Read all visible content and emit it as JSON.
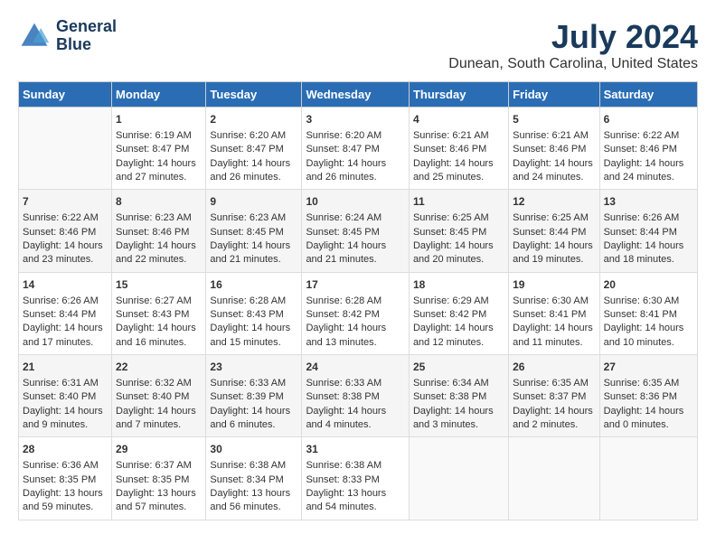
{
  "logo": {
    "line1": "General",
    "line2": "Blue"
  },
  "title": "July 2024",
  "subtitle": "Dunean, South Carolina, United States",
  "days_of_week": [
    "Sunday",
    "Monday",
    "Tuesday",
    "Wednesday",
    "Thursday",
    "Friday",
    "Saturday"
  ],
  "weeks": [
    [
      {
        "day": "",
        "sunrise": "",
        "sunset": "",
        "daylight": ""
      },
      {
        "day": "1",
        "sunrise": "Sunrise: 6:19 AM",
        "sunset": "Sunset: 8:47 PM",
        "daylight": "Daylight: 14 hours and 27 minutes."
      },
      {
        "day": "2",
        "sunrise": "Sunrise: 6:20 AM",
        "sunset": "Sunset: 8:47 PM",
        "daylight": "Daylight: 14 hours and 26 minutes."
      },
      {
        "day": "3",
        "sunrise": "Sunrise: 6:20 AM",
        "sunset": "Sunset: 8:47 PM",
        "daylight": "Daylight: 14 hours and 26 minutes."
      },
      {
        "day": "4",
        "sunrise": "Sunrise: 6:21 AM",
        "sunset": "Sunset: 8:46 PM",
        "daylight": "Daylight: 14 hours and 25 minutes."
      },
      {
        "day": "5",
        "sunrise": "Sunrise: 6:21 AM",
        "sunset": "Sunset: 8:46 PM",
        "daylight": "Daylight: 14 hours and 24 minutes."
      },
      {
        "day": "6",
        "sunrise": "Sunrise: 6:22 AM",
        "sunset": "Sunset: 8:46 PM",
        "daylight": "Daylight: 14 hours and 24 minutes."
      }
    ],
    [
      {
        "day": "7",
        "sunrise": "Sunrise: 6:22 AM",
        "sunset": "Sunset: 8:46 PM",
        "daylight": "Daylight: 14 hours and 23 minutes."
      },
      {
        "day": "8",
        "sunrise": "Sunrise: 6:23 AM",
        "sunset": "Sunset: 8:46 PM",
        "daylight": "Daylight: 14 hours and 22 minutes."
      },
      {
        "day": "9",
        "sunrise": "Sunrise: 6:23 AM",
        "sunset": "Sunset: 8:45 PM",
        "daylight": "Daylight: 14 hours and 21 minutes."
      },
      {
        "day": "10",
        "sunrise": "Sunrise: 6:24 AM",
        "sunset": "Sunset: 8:45 PM",
        "daylight": "Daylight: 14 hours and 21 minutes."
      },
      {
        "day": "11",
        "sunrise": "Sunrise: 6:25 AM",
        "sunset": "Sunset: 8:45 PM",
        "daylight": "Daylight: 14 hours and 20 minutes."
      },
      {
        "day": "12",
        "sunrise": "Sunrise: 6:25 AM",
        "sunset": "Sunset: 8:44 PM",
        "daylight": "Daylight: 14 hours and 19 minutes."
      },
      {
        "day": "13",
        "sunrise": "Sunrise: 6:26 AM",
        "sunset": "Sunset: 8:44 PM",
        "daylight": "Daylight: 14 hours and 18 minutes."
      }
    ],
    [
      {
        "day": "14",
        "sunrise": "Sunrise: 6:26 AM",
        "sunset": "Sunset: 8:44 PM",
        "daylight": "Daylight: 14 hours and 17 minutes."
      },
      {
        "day": "15",
        "sunrise": "Sunrise: 6:27 AM",
        "sunset": "Sunset: 8:43 PM",
        "daylight": "Daylight: 14 hours and 16 minutes."
      },
      {
        "day": "16",
        "sunrise": "Sunrise: 6:28 AM",
        "sunset": "Sunset: 8:43 PM",
        "daylight": "Daylight: 14 hours and 15 minutes."
      },
      {
        "day": "17",
        "sunrise": "Sunrise: 6:28 AM",
        "sunset": "Sunset: 8:42 PM",
        "daylight": "Daylight: 14 hours and 13 minutes."
      },
      {
        "day": "18",
        "sunrise": "Sunrise: 6:29 AM",
        "sunset": "Sunset: 8:42 PM",
        "daylight": "Daylight: 14 hours and 12 minutes."
      },
      {
        "day": "19",
        "sunrise": "Sunrise: 6:30 AM",
        "sunset": "Sunset: 8:41 PM",
        "daylight": "Daylight: 14 hours and 11 minutes."
      },
      {
        "day": "20",
        "sunrise": "Sunrise: 6:30 AM",
        "sunset": "Sunset: 8:41 PM",
        "daylight": "Daylight: 14 hours and 10 minutes."
      }
    ],
    [
      {
        "day": "21",
        "sunrise": "Sunrise: 6:31 AM",
        "sunset": "Sunset: 8:40 PM",
        "daylight": "Daylight: 14 hours and 9 minutes."
      },
      {
        "day": "22",
        "sunrise": "Sunrise: 6:32 AM",
        "sunset": "Sunset: 8:40 PM",
        "daylight": "Daylight: 14 hours and 7 minutes."
      },
      {
        "day": "23",
        "sunrise": "Sunrise: 6:33 AM",
        "sunset": "Sunset: 8:39 PM",
        "daylight": "Daylight: 14 hours and 6 minutes."
      },
      {
        "day": "24",
        "sunrise": "Sunrise: 6:33 AM",
        "sunset": "Sunset: 8:38 PM",
        "daylight": "Daylight: 14 hours and 4 minutes."
      },
      {
        "day": "25",
        "sunrise": "Sunrise: 6:34 AM",
        "sunset": "Sunset: 8:38 PM",
        "daylight": "Daylight: 14 hours and 3 minutes."
      },
      {
        "day": "26",
        "sunrise": "Sunrise: 6:35 AM",
        "sunset": "Sunset: 8:37 PM",
        "daylight": "Daylight: 14 hours and 2 minutes."
      },
      {
        "day": "27",
        "sunrise": "Sunrise: 6:35 AM",
        "sunset": "Sunset: 8:36 PM",
        "daylight": "Daylight: 14 hours and 0 minutes."
      }
    ],
    [
      {
        "day": "28",
        "sunrise": "Sunrise: 6:36 AM",
        "sunset": "Sunset: 8:35 PM",
        "daylight": "Daylight: 13 hours and 59 minutes."
      },
      {
        "day": "29",
        "sunrise": "Sunrise: 6:37 AM",
        "sunset": "Sunset: 8:35 PM",
        "daylight": "Daylight: 13 hours and 57 minutes."
      },
      {
        "day": "30",
        "sunrise": "Sunrise: 6:38 AM",
        "sunset": "Sunset: 8:34 PM",
        "daylight": "Daylight: 13 hours and 56 minutes."
      },
      {
        "day": "31",
        "sunrise": "Sunrise: 6:38 AM",
        "sunset": "Sunset: 8:33 PM",
        "daylight": "Daylight: 13 hours and 54 minutes."
      },
      {
        "day": "",
        "sunrise": "",
        "sunset": "",
        "daylight": ""
      },
      {
        "day": "",
        "sunrise": "",
        "sunset": "",
        "daylight": ""
      },
      {
        "day": "",
        "sunrise": "",
        "sunset": "",
        "daylight": ""
      }
    ]
  ]
}
